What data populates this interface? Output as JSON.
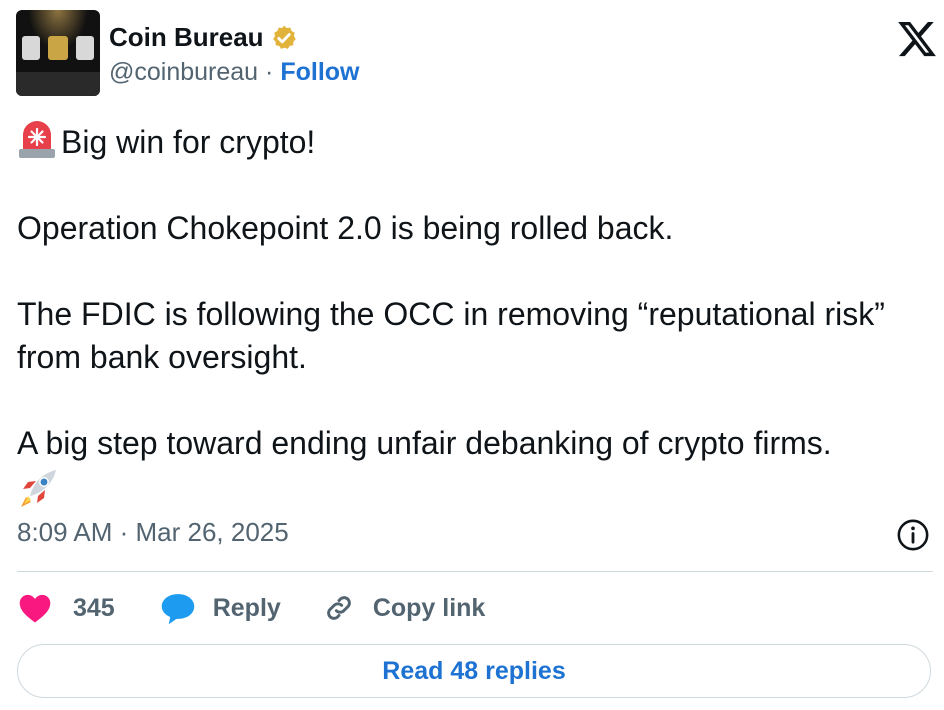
{
  "author": {
    "name": "Coin Bureau",
    "handle": "@coinbureau",
    "separator": "·",
    "follow_label": "Follow",
    "avatar_icon": "award-plaques-avatar",
    "verified_icon": "verified-badge-icon",
    "verified_color": "#e2b33a"
  },
  "platform_icon": "x-logo-icon",
  "tweet": {
    "emoji_lead": "rotating-light-emoji",
    "line1": "Big win for crypto!",
    "line2": "Operation Chokepoint 2.0 is being rolled back.",
    "line3": "The FDIC is following the OCC in removing “reputational risk” from bank oversight.",
    "line4": "A big step toward ending unfair debanking of crypto firms.",
    "emoji_trail": "rocket-emoji"
  },
  "timestamp": "8:09 AM · Mar 26, 2025",
  "actions": {
    "like_count": "345",
    "reply_label": "Reply",
    "copy_link_label": "Copy link"
  },
  "read_replies_label": "Read 48 replies",
  "colors": {
    "accent": "#1d72d2",
    "like": "#f91880",
    "reply_bubble": "#1d9bf0",
    "text": "#0f1419",
    "muted": "#536471",
    "border": "#cfd9de"
  }
}
